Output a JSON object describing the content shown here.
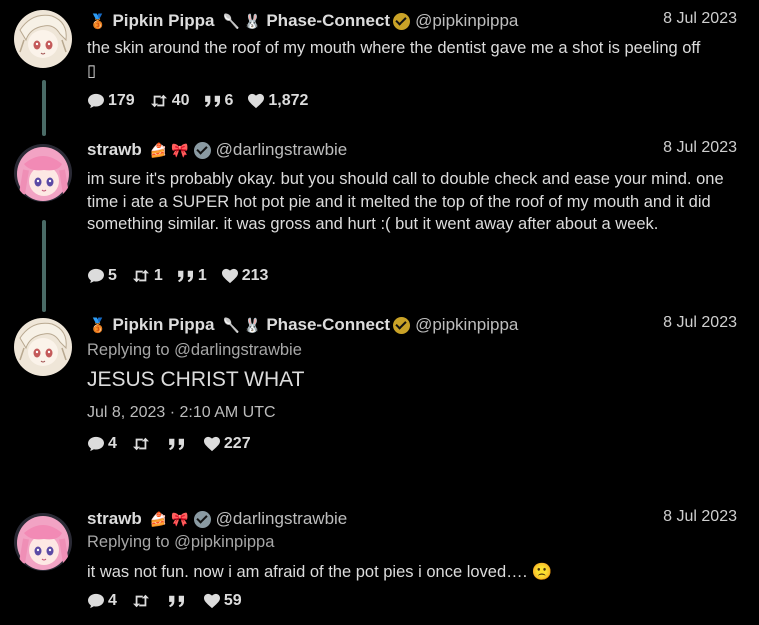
{
  "tweets": [
    {
      "name": "Pipkin Pippa",
      "org": "Phase-Connect",
      "handle": "@pipkinpippa",
      "date": "8 Jul 2023",
      "text": "the skin around the roof of my mouth where the dentist gave me a shot is peeling off",
      "text_tail": "▯",
      "stats": {
        "replies": "179",
        "retweets": "40",
        "quotes": "6",
        "likes": "1,872"
      }
    },
    {
      "name": "strawb",
      "handle": "@darlingstrawbie",
      "date": "8 Jul 2023",
      "text": "im sure it's probably okay. but you should call to double check and ease your mind. one time i ate a SUPER hot pot pie and it melted the top of the roof of my mouth and it did something similar. it was gross and hurt :( but it went away after about a week.",
      "stats": {
        "replies": "5",
        "retweets": "1",
        "quotes": "1",
        "likes": "213"
      }
    },
    {
      "name": "Pipkin Pippa",
      "org": "Phase-Connect",
      "handle": "@pipkinpippa",
      "date": "8 Jul 2023",
      "reply_label": "Replying to",
      "reply_to": "@darlingstrawbie",
      "text": "JESUS CHRIST WHAT",
      "timestamp": "Jul 8, 2023 · 2:10 AM UTC",
      "stats": {
        "replies": "4",
        "retweets": "",
        "quotes": "",
        "likes": "227"
      }
    },
    {
      "name": "strawb",
      "handle": "@darlingstrawbie",
      "date": "8 Jul 2023",
      "reply_label": "Replying to",
      "reply_to": "@pipkinpippa",
      "text": "it was not fun. now i am afraid of the pot pies i once loved….",
      "text_emoji": "🙁",
      "stats": {
        "replies": "4",
        "retweets": "",
        "quotes": "",
        "likes": "59"
      }
    }
  ],
  "colors": {
    "background": "#000000",
    "thread_line": "#4a6b66",
    "text": "#dcdcdc",
    "gold_verified": "#c9a227"
  },
  "icons": [
    "medal-icon",
    "spoon-icon",
    "bunny-icon",
    "verified-icon",
    "cake-icon",
    "bow-icon",
    "reply-icon",
    "retweet-icon",
    "quote-icon",
    "heart-icon"
  ]
}
